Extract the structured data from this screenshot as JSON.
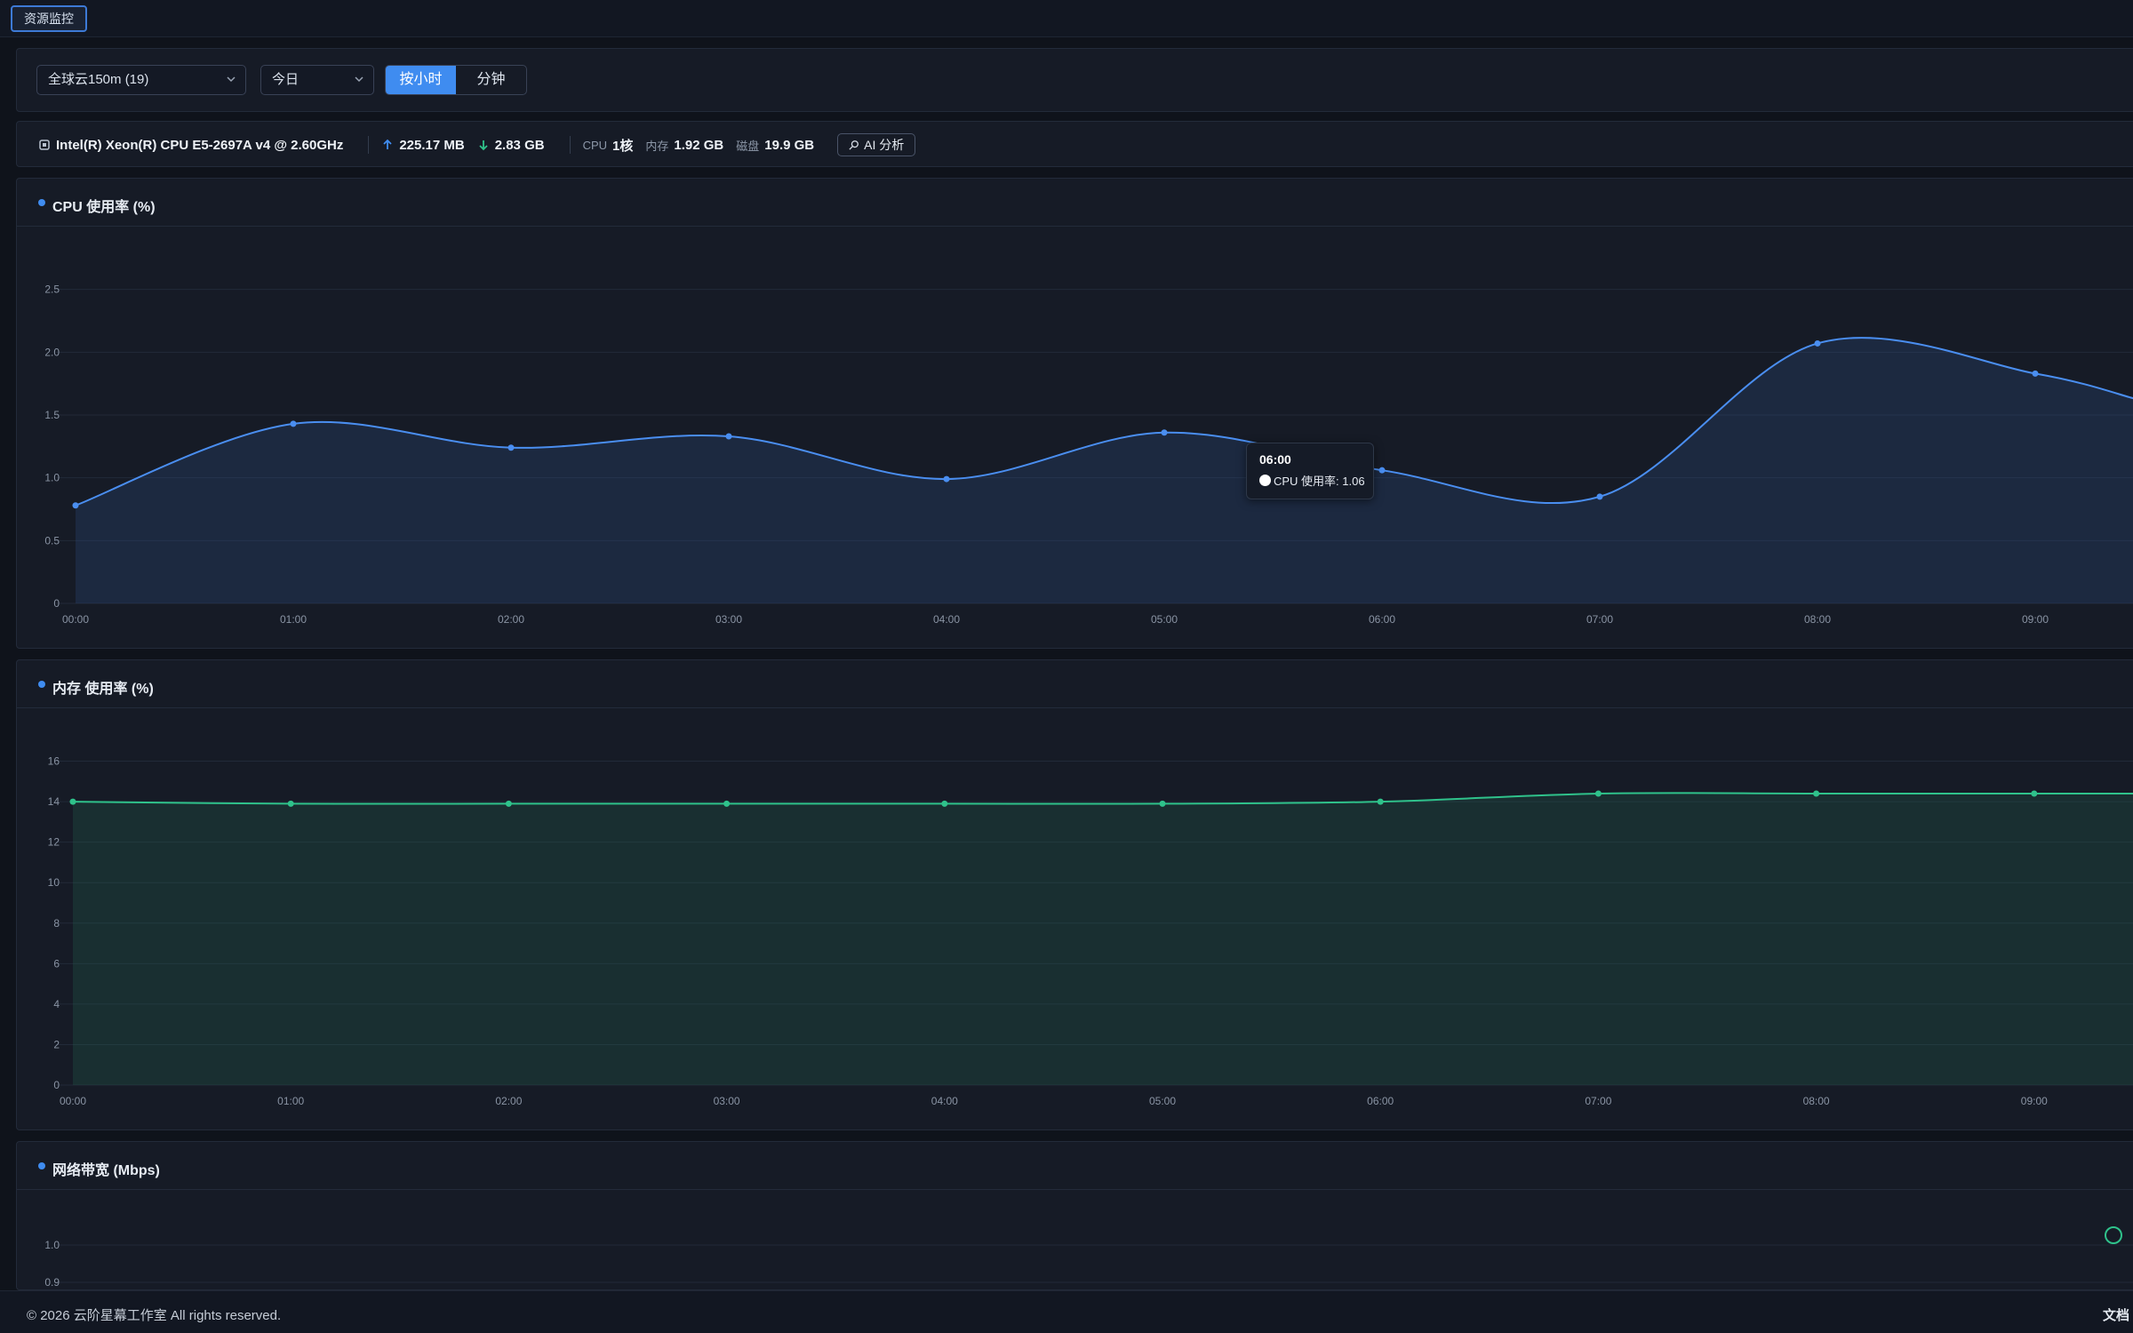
{
  "topbar": {
    "tab_label": "资源监控"
  },
  "filters": {
    "server_select": "全球云150m (19)",
    "range_select": "今日",
    "granularity": [
      "按小时",
      "分钟"
    ],
    "active_granularity": "按小时"
  },
  "server_info": {
    "cpu_model": "Intel(R) Xeon(R) CPU E5-2697A v4 @ 2.60GHz",
    "upload": "225.17 MB",
    "download": "2.83 GB",
    "cpu_label": "CPU",
    "cpu_value": "1核",
    "mem_label": "内存",
    "mem_value": "1.92 GB",
    "disk_label": "磁盘",
    "disk_value": "19.9 GB",
    "ai_button": "AI 分析"
  },
  "tooltip": {
    "time": "06:00",
    "text": "CPU 使用率: 1.06"
  },
  "footer": {
    "copyright": "© 2026 云阶星幕工作室 All rights reserved.",
    "docs": "文档"
  },
  "colors": {
    "accent": "#3f8cf0",
    "cpu_line": "#4a8ef0",
    "mem_line": "#2fc28b",
    "bg": "#0f131b"
  },
  "chart_data": [
    {
      "type": "area",
      "title": "CPU 使用率 (%)",
      "x": [
        "00:00",
        "01:00",
        "02:00",
        "03:00",
        "04:00",
        "05:00",
        "06:00",
        "07:00",
        "08:00",
        "09:00"
      ],
      "series": [
        {
          "values": [
            0.78,
            1.43,
            1.24,
            1.33,
            0.99,
            1.36,
            1.06,
            0.85,
            2.07,
            1.83
          ]
        }
      ],
      "yticks": [
        "0",
        "0.5",
        "1.0",
        "1.5",
        "2.0",
        "2.5"
      ],
      "ylim": [
        0,
        3
      ],
      "grid": true
    },
    {
      "type": "area",
      "title": "内存 使用率 (%)",
      "x": [
        "00:00",
        "01:00",
        "02:00",
        "03:00",
        "04:00",
        "05:00",
        "06:00",
        "07:00",
        "08:00",
        "09:00"
      ],
      "series": [
        {
          "values": [
            14.0,
            13.9,
            13.9,
            13.9,
            13.9,
            13.9,
            14.0,
            14.4,
            14.4,
            14.4
          ]
        }
      ],
      "yticks": [
        "0",
        "2",
        "4",
        "6",
        "8",
        "10",
        "12",
        "14",
        "16"
      ],
      "ylim": [
        0,
        18
      ],
      "grid": true
    },
    {
      "type": "line",
      "title": "网络带宽 (Mbps)",
      "yticks": [
        "0.9",
        "1.0"
      ],
      "grid": true
    }
  ]
}
